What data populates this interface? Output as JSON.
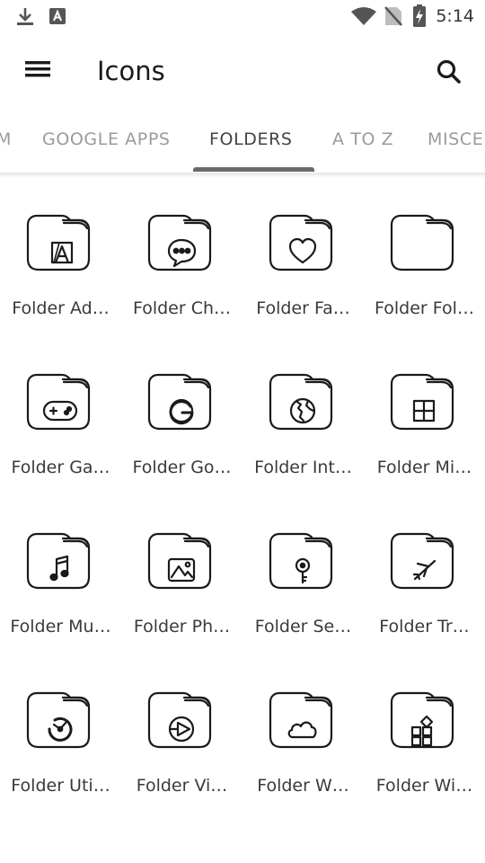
{
  "status_bar": {
    "time": "5:14",
    "left_icons": [
      "download-icon",
      "font-a-icon"
    ],
    "right_icons": [
      "wifi-icon",
      "no-sim-icon",
      "battery-charging-icon"
    ]
  },
  "app_bar": {
    "title": "Icons",
    "menu_icon": "hamburger-menu-icon",
    "search_icon": "search-icon"
  },
  "tabs": [
    {
      "label": "M",
      "active": false
    },
    {
      "label": "GOOGLE APPS",
      "active": false
    },
    {
      "label": "FOLDERS",
      "active": true
    },
    {
      "label": "A TO Z",
      "active": false
    },
    {
      "label": "MISCE",
      "active": false
    }
  ],
  "icons": [
    {
      "label": "Folder Ad…",
      "glyph": "adobe"
    },
    {
      "label": "Folder Ch…",
      "glyph": "chat"
    },
    {
      "label": "Folder Fa…",
      "glyph": "heart"
    },
    {
      "label": "Folder Fol…",
      "glyph": "none"
    },
    {
      "label": "Folder Ga…",
      "glyph": "gamepad"
    },
    {
      "label": "Folder Go…",
      "glyph": "google"
    },
    {
      "label": "Folder Int…",
      "glyph": "globe"
    },
    {
      "label": "Folder Mi…",
      "glyph": "windows"
    },
    {
      "label": "Folder Mu…",
      "glyph": "music"
    },
    {
      "label": "Folder Ph…",
      "glyph": "photo"
    },
    {
      "label": "Folder Se…",
      "glyph": "key"
    },
    {
      "label": "Folder Tr…",
      "glyph": "plane"
    },
    {
      "label": "Folder Uti…",
      "glyph": "gauge"
    },
    {
      "label": "Folder Vi…",
      "glyph": "play"
    },
    {
      "label": "Folder W…",
      "glyph": "cloud"
    },
    {
      "label": "Folder Wi…",
      "glyph": "widgets"
    }
  ],
  "colors": {
    "active_tab": "#444444",
    "inactive_tab": "#9a9a9a",
    "indicator": "#6a6a6a",
    "icon_stroke": "#1a1a1a"
  }
}
